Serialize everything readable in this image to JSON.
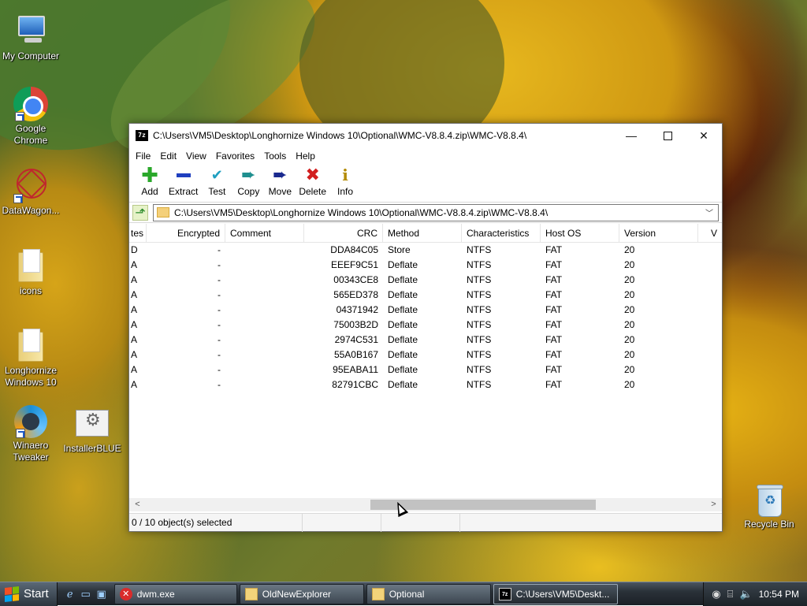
{
  "desktop": {
    "icons": [
      {
        "label": "My Computer"
      },
      {
        "label": "Google Chrome"
      },
      {
        "label": "DataWagon..."
      },
      {
        "label": "icons"
      },
      {
        "label": "Longhornize Windows 10"
      },
      {
        "label": "Winaero Tweaker"
      },
      {
        "label": "InstallerBLUE"
      },
      {
        "label": "Recycle Bin"
      }
    ]
  },
  "window": {
    "title": "C:\\Users\\VM5\\Desktop\\Longhornize Windows 10\\Optional\\WMC-V8.8.4.zip\\WMC-V8.8.4\\",
    "app_icon_text": "7z",
    "controls": {
      "minimize": "—",
      "maximize": "",
      "close": "✕"
    },
    "menu": [
      "File",
      "Edit",
      "View",
      "Favorites",
      "Tools",
      "Help"
    ],
    "toolbar": [
      {
        "label": "Add",
        "icon": "add-icon"
      },
      {
        "label": "Extract",
        "icon": "extract-icon"
      },
      {
        "label": "Test",
        "icon": "test-icon"
      },
      {
        "label": "Copy",
        "icon": "copy-icon"
      },
      {
        "label": "Move",
        "icon": "move-icon"
      },
      {
        "label": "Delete",
        "icon": "delete-icon"
      },
      {
        "label": "Info",
        "icon": "info-icon"
      }
    ],
    "address": "C:\\Users\\VM5\\Desktop\\Longhornize Windows 10\\Optional\\WMC-V8.8.4.zip\\WMC-V8.8.4\\",
    "columns": [
      "tes",
      "Encrypted",
      "Comment",
      "CRC",
      "Method",
      "Characteristics",
      "Host OS",
      "Version",
      "V"
    ],
    "rows": [
      {
        "attr": "D",
        "encrypted": "-",
        "comment": "",
        "crc": "DDA84C05",
        "method": "Store",
        "characteristics": "NTFS",
        "host_os": "FAT",
        "version": "20"
      },
      {
        "attr": "A",
        "encrypted": "-",
        "comment": "",
        "crc": "EEEF9C51",
        "method": "Deflate",
        "characteristics": "NTFS",
        "host_os": "FAT",
        "version": "20"
      },
      {
        "attr": "A",
        "encrypted": "-",
        "comment": "",
        "crc": "00343CE8",
        "method": "Deflate",
        "characteristics": "NTFS",
        "host_os": "FAT",
        "version": "20"
      },
      {
        "attr": "A",
        "encrypted": "-",
        "comment": "",
        "crc": "565ED378",
        "method": "Deflate",
        "characteristics": "NTFS",
        "host_os": "FAT",
        "version": "20"
      },
      {
        "attr": "A",
        "encrypted": "-",
        "comment": "",
        "crc": "04371942",
        "method": "Deflate",
        "characteristics": "NTFS",
        "host_os": "FAT",
        "version": "20"
      },
      {
        "attr": "A",
        "encrypted": "-",
        "comment": "",
        "crc": "75003B2D",
        "method": "Deflate",
        "characteristics": "NTFS",
        "host_os": "FAT",
        "version": "20"
      },
      {
        "attr": "A",
        "encrypted": "-",
        "comment": "",
        "crc": "2974C531",
        "method": "Deflate",
        "characteristics": "NTFS",
        "host_os": "FAT",
        "version": "20"
      },
      {
        "attr": "A",
        "encrypted": "-",
        "comment": "",
        "crc": "55A0B167",
        "method": "Deflate",
        "characteristics": "NTFS",
        "host_os": "FAT",
        "version": "20"
      },
      {
        "attr": "A",
        "encrypted": "-",
        "comment": "",
        "crc": "95EABA11",
        "method": "Deflate",
        "characteristics": "NTFS",
        "host_os": "FAT",
        "version": "20"
      },
      {
        "attr": "A",
        "encrypted": "-",
        "comment": "",
        "crc": "82791CBC",
        "method": "Deflate",
        "characteristics": "NTFS",
        "host_os": "FAT",
        "version": "20"
      }
    ],
    "status": [
      "0 / 10 object(s) selected",
      "",
      "",
      ""
    ]
  },
  "taskbar": {
    "start_label": "Start",
    "tasks": [
      {
        "label": "dwm.exe",
        "icon": "error-icon"
      },
      {
        "label": "OldNewExplorer",
        "icon": "folder-icon"
      },
      {
        "label": "Optional",
        "icon": "folder-icon"
      },
      {
        "label": "C:\\Users\\VM5\\Deskt...",
        "icon": "7zip-icon"
      }
    ],
    "clock": "10:54 PM"
  }
}
